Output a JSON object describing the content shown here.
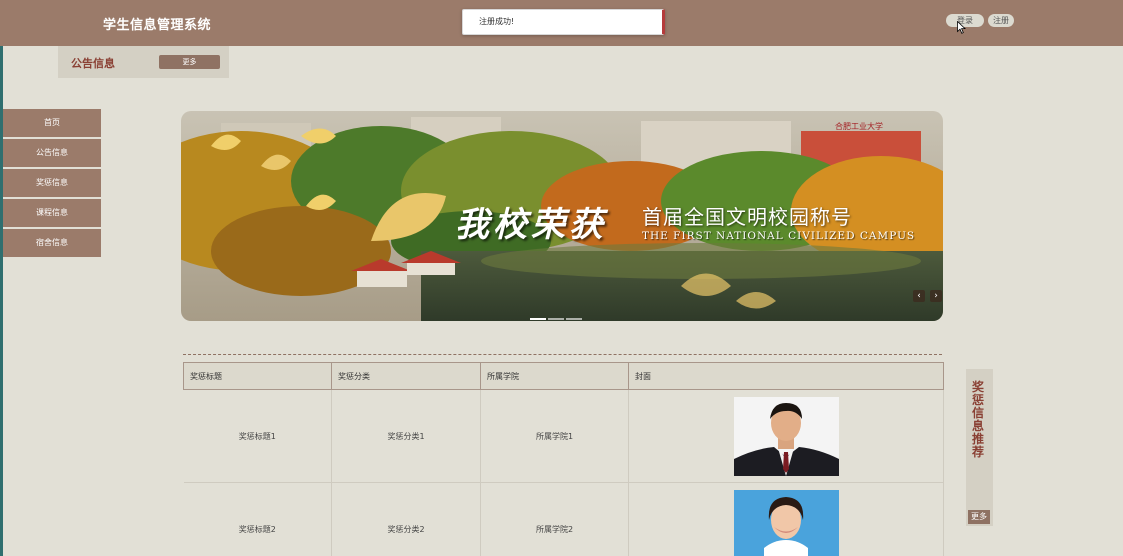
{
  "header": {
    "brand": "学生信息管理系统",
    "toast": "注册成功!",
    "login_label": "登录",
    "register_label": "注册"
  },
  "notice": {
    "title": "公告信息",
    "more_label": "更多"
  },
  "sidebar": {
    "items": [
      {
        "label": "首页"
      },
      {
        "label": "公告信息"
      },
      {
        "label": "奖惩信息"
      },
      {
        "label": "课程信息"
      },
      {
        "label": "宿舍信息"
      }
    ]
  },
  "banner": {
    "headline": "我校荣获",
    "subtitle": "首届全国文明校园称号",
    "english": "THE FIRST NATIONAL CIVILIZED CAMPUS",
    "school_name": "合肥工业大学",
    "prev_icon": "chevron-left",
    "next_icon": "chevron-right"
  },
  "table": {
    "headers": [
      "奖惩标题",
      "奖惩分类",
      "所属学院",
      "封面"
    ],
    "rows": [
      {
        "title": "奖惩标题1",
        "category": "奖惩分类1",
        "college": "所属学院1"
      },
      {
        "title": "奖惩标题2",
        "category": "奖惩分类2",
        "college": "所属学院2"
      }
    ]
  },
  "recommend": {
    "title": "奖惩信息推荐",
    "more_label": "更多"
  },
  "colors": {
    "header_bg": "#9b7b6a",
    "page_bg": "#e2e0d6",
    "accent_text": "#8a4034",
    "button_bg": "#8f7263"
  }
}
